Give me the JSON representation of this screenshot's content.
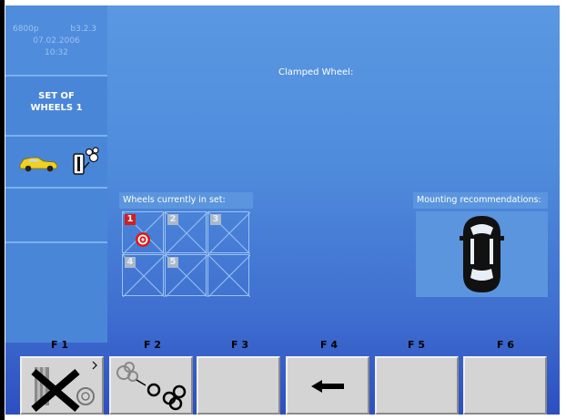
{
  "status": {
    "model": "6800p",
    "version": "b3.2.3",
    "date": "07.02.2006",
    "time": "10:32"
  },
  "sidebar": {
    "set_label_line1": "SET OF",
    "set_label_line2": "WHEELS 1",
    "mode_icons": [
      "car-icon",
      "wheel-balancer-icon"
    ]
  },
  "header": {
    "clamped_wheel_label": "Clamped Wheel:"
  },
  "wheels_panel": {
    "title": "Wheels currently in set:",
    "slots": [
      {
        "label": "1",
        "active": true,
        "target": true
      },
      {
        "label": "2",
        "active": false,
        "target": false
      },
      {
        "label": "3",
        "active": false,
        "target": false
      },
      {
        "label": "4",
        "active": false,
        "target": false
      },
      {
        "label": "5",
        "active": false,
        "target": false
      },
      {
        "label": "",
        "active": false,
        "target": false
      }
    ]
  },
  "mounting_panel": {
    "title": "Mounting recommendations:",
    "icon": "car-top-view-icon"
  },
  "function_keys": [
    {
      "label": "F 1",
      "icon": "cancel-x-icon"
    },
    {
      "label": "F 2",
      "icon": "wheel-set-icon"
    },
    {
      "label": "F 3",
      "icon": ""
    },
    {
      "label": "F 4",
      "icon": "arrow-left-icon"
    },
    {
      "label": "F 5",
      "icon": ""
    },
    {
      "label": "F 6",
      "icon": ""
    }
  ],
  "colors": {
    "screen_blue": "#4f8bdb",
    "active_red": "#d11e1e",
    "button_gray": "#d4d4d4"
  }
}
